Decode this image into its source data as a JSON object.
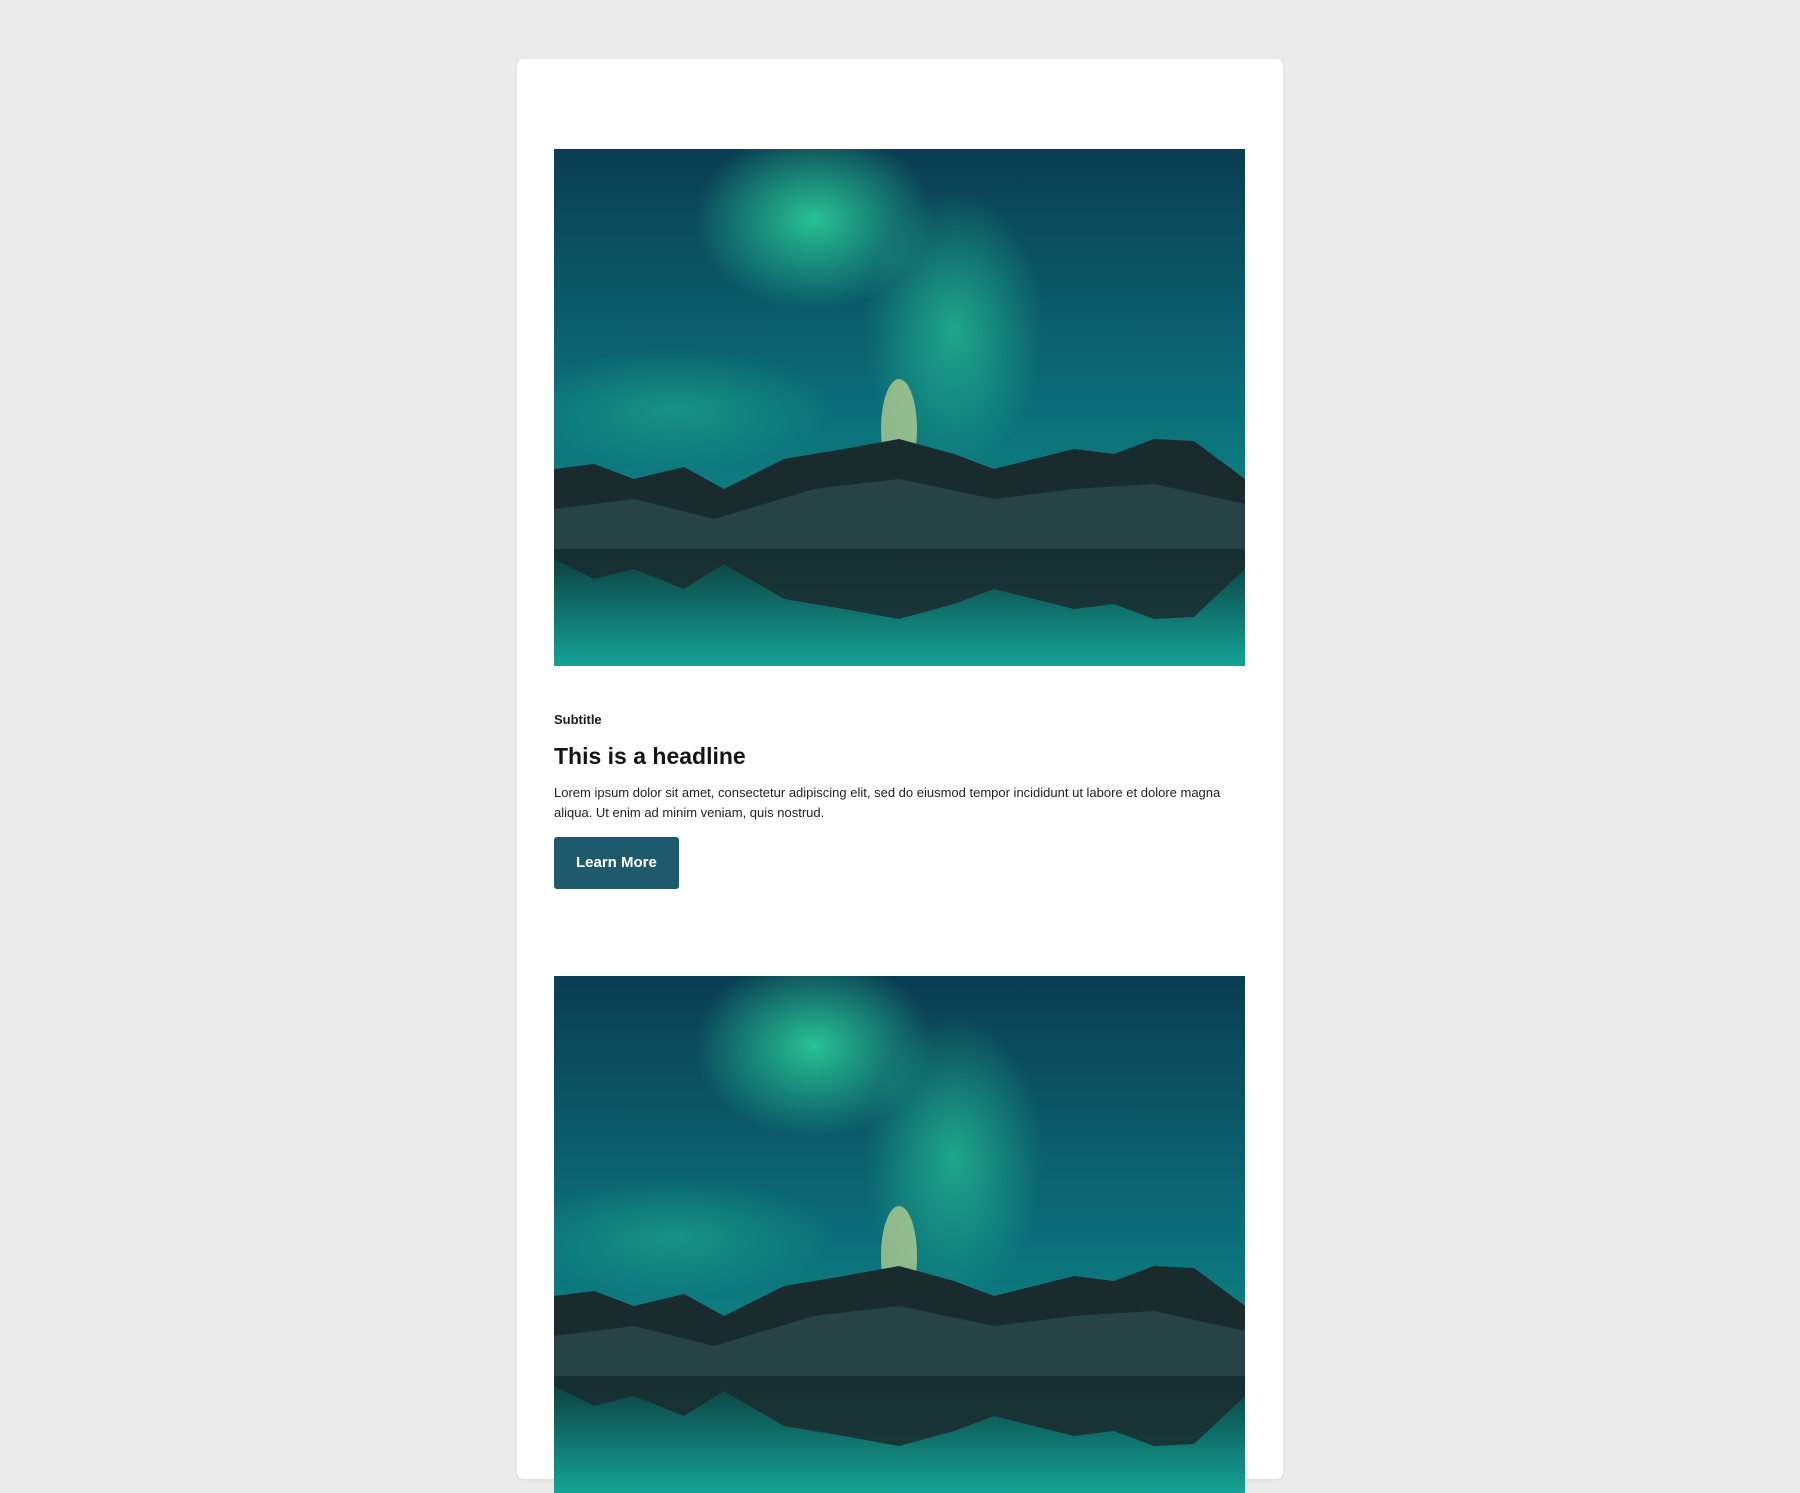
{
  "sections": [
    {
      "image": {
        "icon": "aurora-mountain-lake-image"
      },
      "subtitle": "Subtitle",
      "headline": "This is a headline",
      "body": "Lorem ipsum dolor sit amet, consectetur adipiscing elit, sed do eiusmod tempor incididunt ut labore et dolore magna aliqua. Ut enim ad minim veniam, quis nostrud.",
      "button_label": "Learn More"
    },
    {
      "image": {
        "icon": "aurora-mountain-lake-image"
      }
    }
  ],
  "colors": {
    "page_background": "#ebebeb",
    "card_background": "#ffffff",
    "button_background": "#1e5a6c",
    "button_text": "#ffffff",
    "sky_top": "#0a3d52",
    "aurora": "#1fc28f"
  }
}
